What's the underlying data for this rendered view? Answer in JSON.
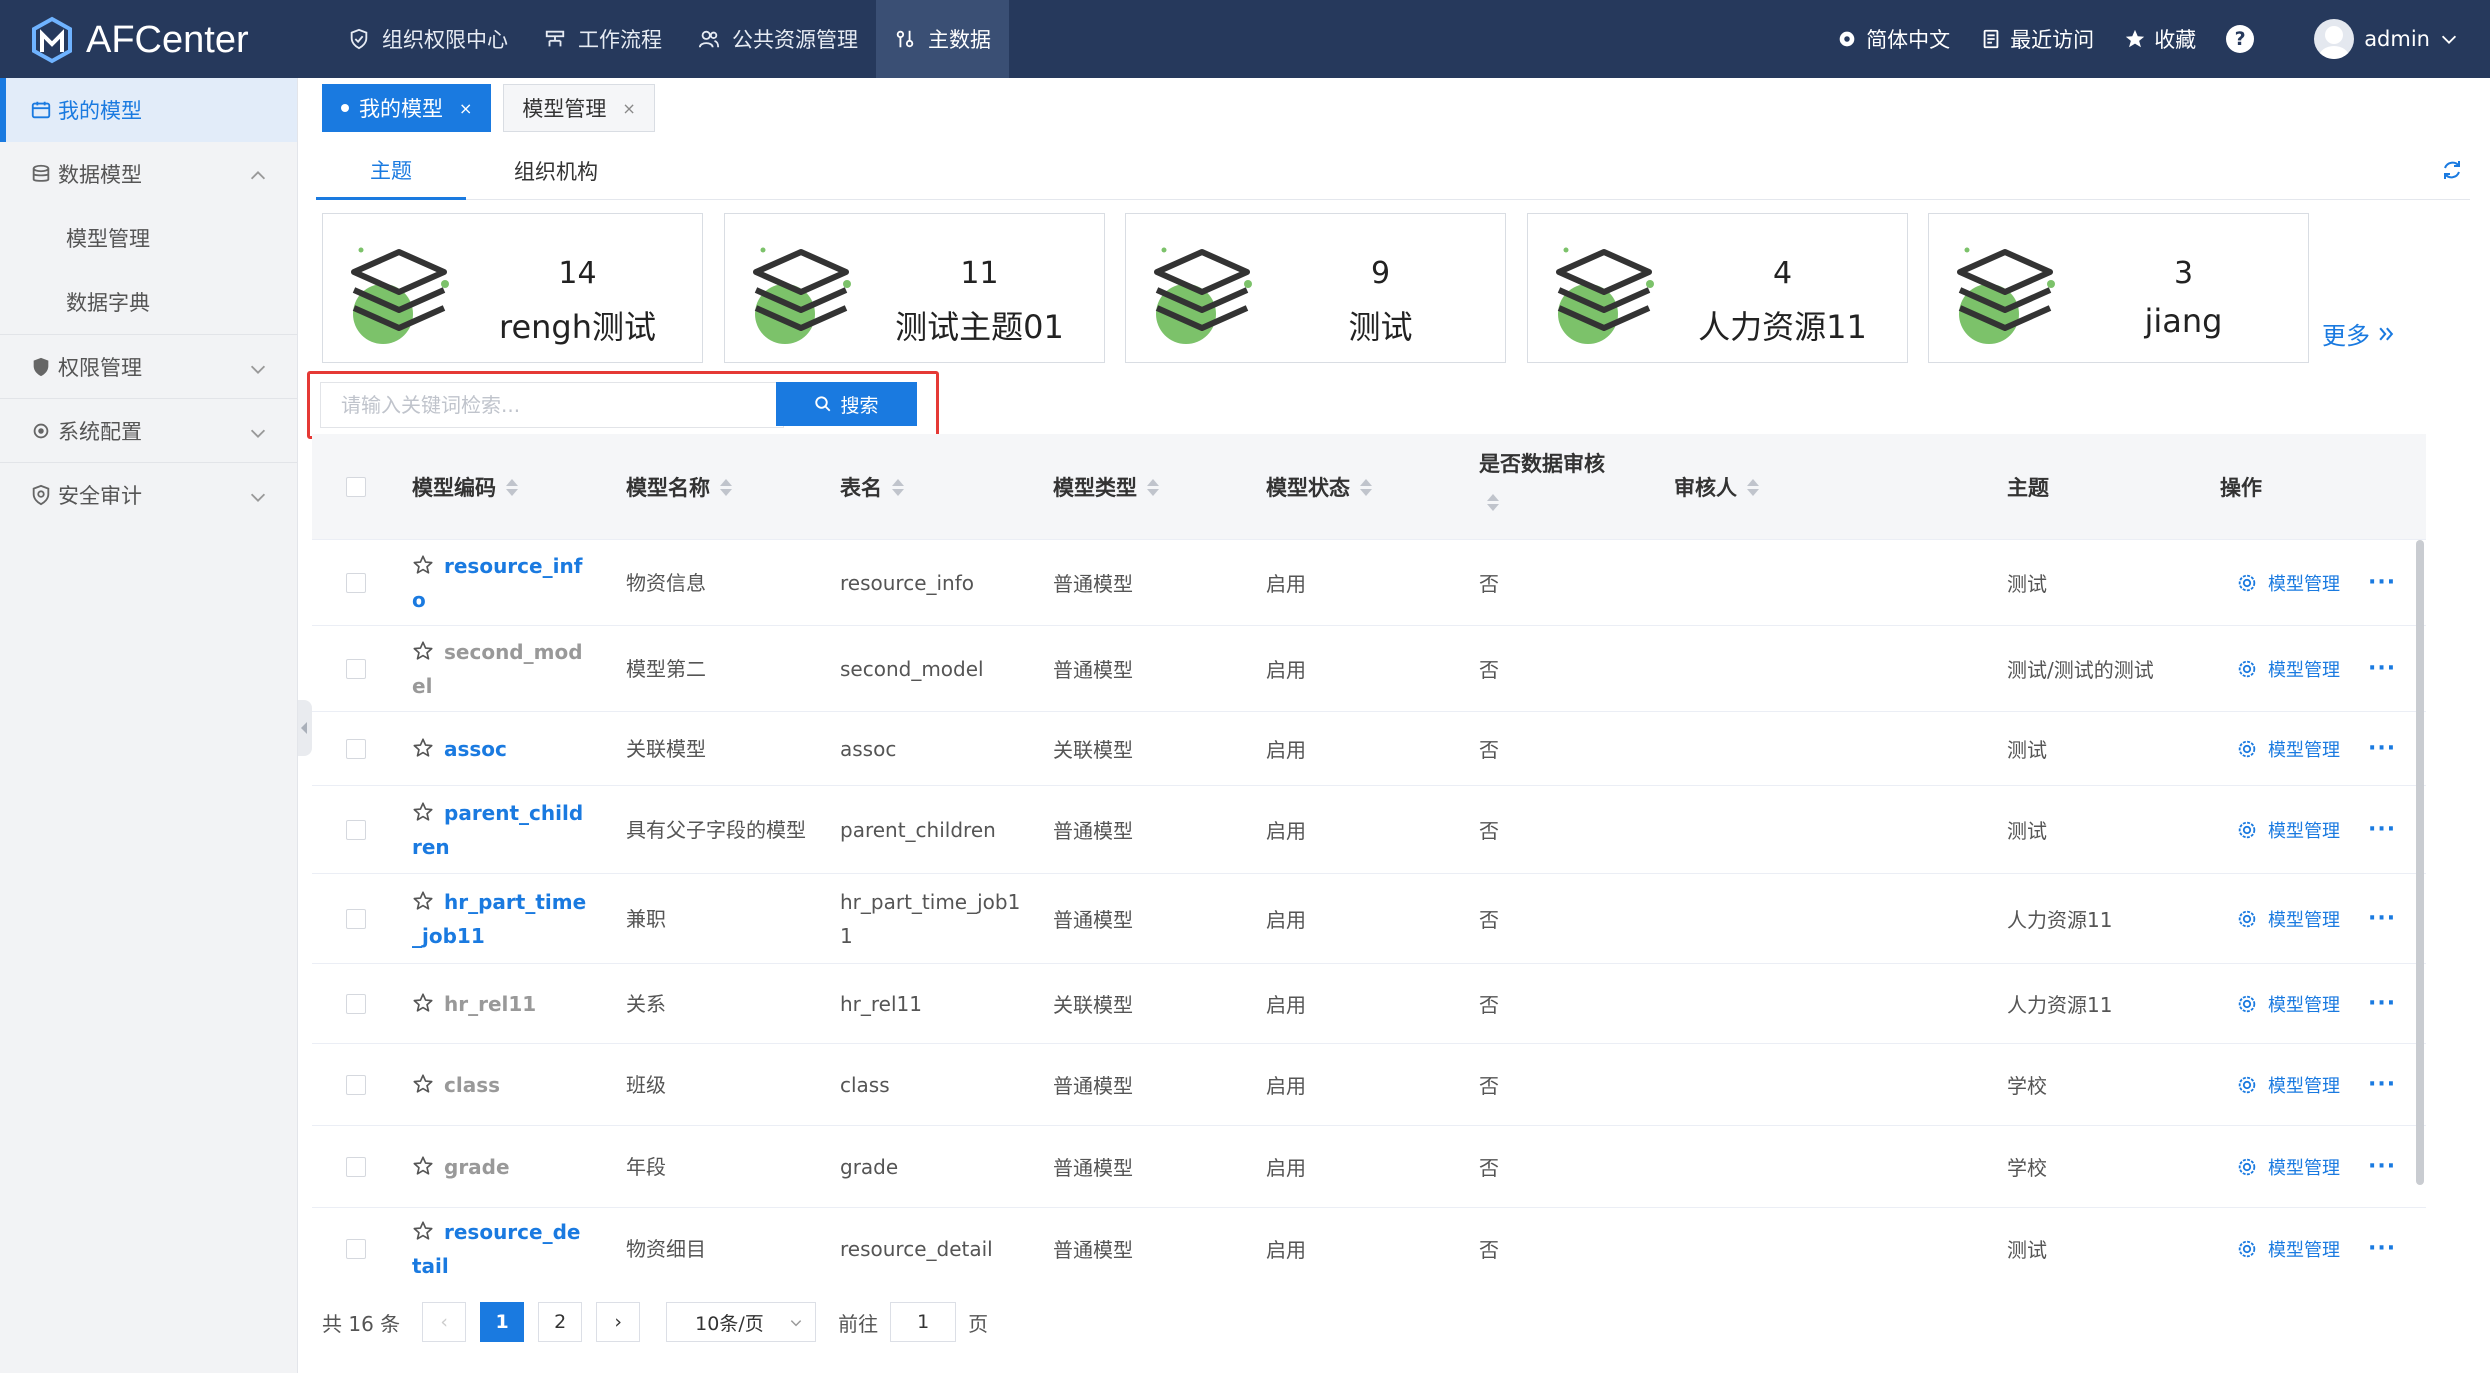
{
  "app": {
    "title": "AFCenter"
  },
  "topnav": [
    {
      "label": "组织权限中心",
      "icon": "shield-icon",
      "active": false
    },
    {
      "label": "工作流程",
      "icon": "workflow-icon",
      "active": false
    },
    {
      "label": "公共资源管理",
      "icon": "users-icon",
      "active": false
    },
    {
      "label": "主数据",
      "icon": "master-data-icon",
      "active": true
    }
  ],
  "topright": {
    "language": "简体中文",
    "recent": "最近访问",
    "favorites": "收藏",
    "help": "?",
    "user": "admin"
  },
  "sidebar": {
    "my_models": "我的模型",
    "data_model": "数据模型",
    "model_manage": "模型管理",
    "data_dict": "数据字典",
    "permission": "权限管理",
    "system_config": "系统配置",
    "security_audit": "安全审计"
  },
  "page_tabs": [
    {
      "label": "我的模型",
      "active": true,
      "close": "×"
    },
    {
      "label": "模型管理",
      "active": false,
      "close": "×"
    }
  ],
  "sub_tabs": [
    {
      "label": "主题",
      "active": true
    },
    {
      "label": "组织机构",
      "active": false
    }
  ],
  "theme_cards": [
    {
      "count": "14",
      "name": "rengh测试"
    },
    {
      "count": "11",
      "name": "测试主题01"
    },
    {
      "count": "9",
      "name": "测试"
    },
    {
      "count": "4",
      "name": "人力资源11"
    },
    {
      "count": "3",
      "name": "jiang"
    }
  ],
  "more_label": "更多",
  "search": {
    "placeholder": "请输入关键词检索...",
    "value": "",
    "button": "搜索"
  },
  "table": {
    "columns": {
      "code": "模型编码",
      "name": "模型名称",
      "table": "表名",
      "type": "模型类型",
      "status": "模型状态",
      "audit": "是否数据审核",
      "auditor": "审核人",
      "theme": "主题",
      "ops": "操作"
    },
    "op_label": "模型管理",
    "op_more": "···",
    "rows": [
      {
        "code": "resource_info",
        "code_color": "blue",
        "name": "物资信息",
        "table": "resource_info",
        "type": "普通模型",
        "status": "启用",
        "audit": "否",
        "auditor": "",
        "theme": "测试"
      },
      {
        "code": "second_model",
        "code_color": "gray",
        "name": "模型第二",
        "table": "second_model",
        "type": "普通模型",
        "status": "启用",
        "audit": "否",
        "auditor": "",
        "theme": "测试/测试的测试"
      },
      {
        "code": "assoc",
        "code_color": "blue",
        "name": "关联模型",
        "table": "assoc",
        "type": "关联模型",
        "status": "启用",
        "audit": "否",
        "auditor": "",
        "theme": "测试"
      },
      {
        "code": "parent_children",
        "code_color": "blue",
        "name": "具有父子字段的模型",
        "table": "parent_children",
        "type": "普通模型",
        "status": "启用",
        "audit": "否",
        "auditor": "",
        "theme": "测试"
      },
      {
        "code": "hr_part_time_job11",
        "code_color": "blue",
        "name": "兼职",
        "table": "hr_part_time_job11",
        "type": "普通模型",
        "status": "启用",
        "audit": "否",
        "auditor": "",
        "theme": "人力资源11"
      },
      {
        "code": "hr_rel11",
        "code_color": "gray",
        "name": "关系",
        "table": "hr_rel11",
        "type": "关联模型",
        "status": "启用",
        "audit": "否",
        "auditor": "",
        "theme": "人力资源11"
      },
      {
        "code": "class",
        "code_color": "gray",
        "name": "班级",
        "table": "class",
        "type": "普通模型",
        "status": "启用",
        "audit": "否",
        "auditor": "",
        "theme": "学校"
      },
      {
        "code": "grade",
        "code_color": "gray",
        "name": "年段",
        "table": "grade",
        "type": "普通模型",
        "status": "启用",
        "audit": "否",
        "auditor": "",
        "theme": "学校"
      },
      {
        "code": "resource_detail",
        "code_color": "blue",
        "name": "物资细目",
        "table": "resource_detail",
        "type": "普通模型",
        "status": "启用",
        "audit": "否",
        "auditor": "",
        "theme": "测试"
      }
    ]
  },
  "pagination": {
    "total": "共 16 条",
    "prev": "‹",
    "pages": [
      "1",
      "2"
    ],
    "current": "1",
    "next": "›",
    "page_size": "10条/页",
    "goto_prefix": "前往",
    "goto_value": "1",
    "goto_suffix": "页"
  },
  "colors": {
    "topbar": "#26395c",
    "accent": "#1a7ae0",
    "highlight_border": "#e53935",
    "stack_green": "#7cc26a"
  }
}
